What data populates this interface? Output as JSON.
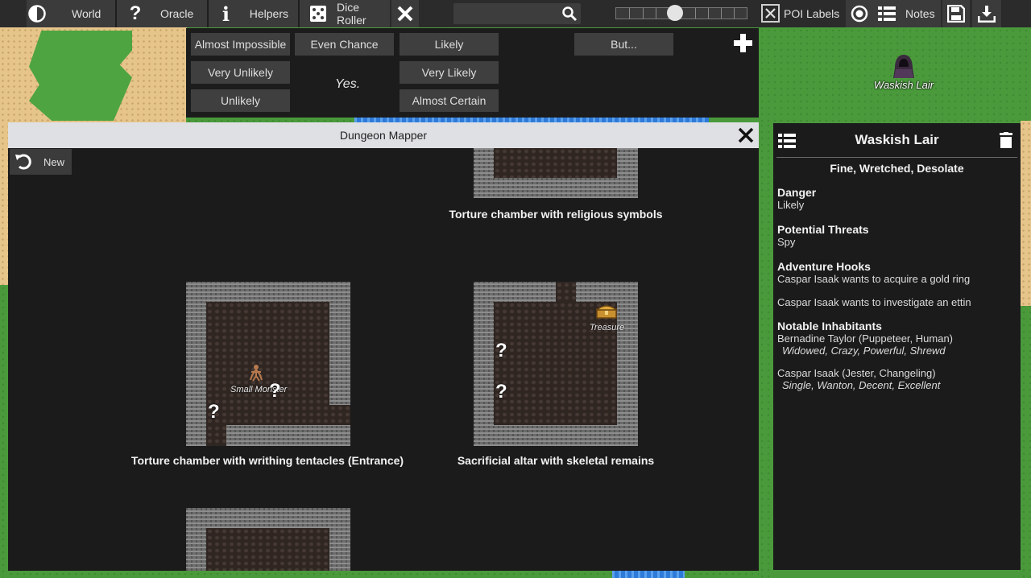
{
  "toolbar": {
    "world_label": "World",
    "oracle_label": "Oracle",
    "helpers_label": "Helpers",
    "dice_label": "Dice Roller",
    "search_placeholder": "",
    "zoom_level": 0.45,
    "poi_labels_label": "POI Labels",
    "notes_label": "Notes"
  },
  "oracle": {
    "options": {
      "almost_impossible": "Almost Impossible",
      "even_chance": "Even Chance",
      "likely": "Likely",
      "very_unlikely": "Very Unlikely",
      "very_likely": "Very Likely",
      "unlikely": "Unlikely",
      "almost_certain": "Almost Certain",
      "but": "But..."
    },
    "answer": "Yes."
  },
  "map": {
    "poi_label": "Waskish Lair"
  },
  "dungeon_mapper": {
    "title": "Dungeon Mapper",
    "new_label": "New",
    "rooms": {
      "top": {
        "caption": "Torture chamber with religious symbols"
      },
      "left": {
        "caption": "Torture chamber with writhing tentacles (Entrance)",
        "monster_label": "Small Monster"
      },
      "right": {
        "caption": "Sacrificial altar with skeletal remains",
        "treasure_label": "Treasure"
      }
    }
  },
  "location": {
    "title": "Waskish Lair",
    "descriptors": "Fine, Wretched, Desolate",
    "danger": {
      "heading": "Danger",
      "value": "Likely"
    },
    "threats": {
      "heading": "Potential Threats",
      "value": "Spy"
    },
    "hooks": {
      "heading": "Adventure Hooks",
      "items": [
        "Caspar Isaak wants to acquire a gold ring",
        "Caspar Isaak wants to investigate an ettin"
      ]
    },
    "inhabitants": {
      "heading": "Notable Inhabitants",
      "people": [
        {
          "name": "Bernadine Taylor (Puppeteer, Human)",
          "traits": "Widowed, Crazy, Powerful, Shrewd"
        },
        {
          "name": "Caspar Isaak (Jester, Changeling)",
          "traits": "Single, Wanton, Decent, Excellent"
        }
      ]
    }
  },
  "colors": {
    "toolbar_bg": "#2b2b2b",
    "button_bg": "#3b3b3b",
    "panel_bg": "#1b1b1b",
    "title_bar": "#dfe0e4",
    "grass": "#4a9a3c",
    "sand": "#e6c58a",
    "water": "#2e7ad8"
  }
}
